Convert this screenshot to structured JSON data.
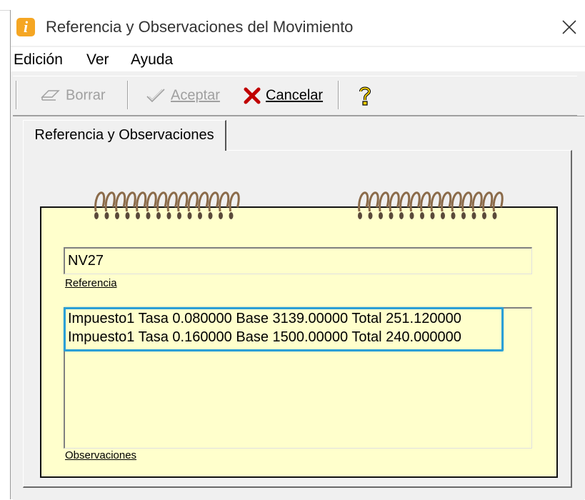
{
  "window": {
    "title": "Referencia y Observaciones del Movimiento"
  },
  "menu": {
    "items": [
      "Edición",
      "Ver",
      "Ayuda"
    ]
  },
  "toolbar": {
    "borrar": {
      "label": "Borrar",
      "enabled": false
    },
    "aceptar": {
      "label": "Aceptar",
      "enabled": false
    },
    "cancelar": {
      "label": "Cancelar",
      "enabled": true
    },
    "help_icon": "help-key-icon"
  },
  "tab": {
    "label": "Referencia y Observaciones"
  },
  "form": {
    "referencia": {
      "value": "NV27",
      "label": "Referencia"
    },
    "observaciones": {
      "lines": [
        "Impuesto1 Tasa 0.080000 Base 3139.00000 Total 251.120000",
        "Impuesto1 Tasa 0.160000 Base 1500.00000 Total 240.000000"
      ],
      "label": "Observaciones"
    }
  },
  "colors": {
    "notepad": "#ffffcc",
    "highlight": "#2b9fd6",
    "cancel_x": "#c00000",
    "spiral": "#8b6b4a"
  }
}
